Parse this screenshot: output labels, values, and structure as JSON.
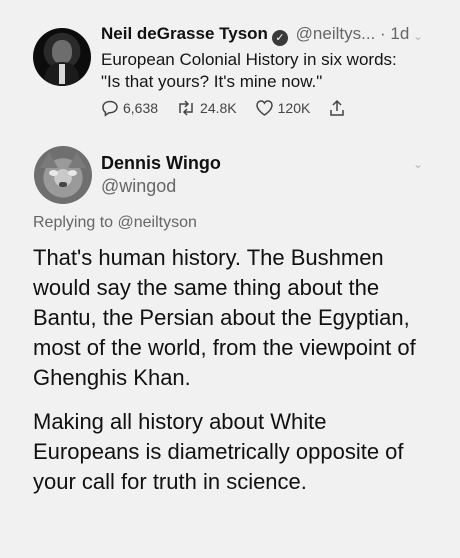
{
  "tweet1": {
    "name": "Neil deGrasse Tyson",
    "handle": "@neiltys...",
    "separator": "·",
    "time": "1d",
    "text_line1": "European Colonial History in six words:",
    "text_line2": "\"Is that yours? It's mine now.\"",
    "replies": "6,638",
    "retweets": "24.8K",
    "likes": "120K"
  },
  "tweet2": {
    "name": "Dennis Wingo",
    "handle": "@wingod",
    "replying_prefix": "Replying to",
    "replying_handle": "@neiltyson",
    "paragraph1": "That's human history.  The Bushmen would say the same thing about the Bantu, the Persian about the Egyptian, most of the world, from the viewpoint of Ghenghis Khan.",
    "paragraph2": "Making all history about White Europeans is diametrically opposite of your call for truth in science."
  },
  "icons": {
    "verified": "verified-check-icon",
    "reply": "reply-icon",
    "retweet": "retweet-icon",
    "like": "heart-icon",
    "share": "share-icon",
    "menu": "chevron-down-icon"
  },
  "colors": {
    "background": "#f1f1f1",
    "text": "#111111",
    "muted": "#666666"
  }
}
